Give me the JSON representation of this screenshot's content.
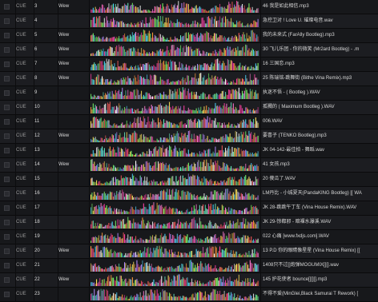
{
  "columns": {
    "cue_label": "CUE"
  },
  "rows": [
    {
      "cue": "CUE",
      "num": "3",
      "tag": "Wew",
      "title": "46 我是如此相信.mp3"
    },
    {
      "cue": "CUE",
      "num": "4",
      "tag": "",
      "title": "急控卫对 ! Love U. 璀璨电音.wav"
    },
    {
      "cue": "CUE",
      "num": "5",
      "tag": "Wew",
      "title": "我的未来式 (FarAlly Bootleg).mp3"
    },
    {
      "cue": "CUE",
      "num": "6",
      "tag": "Wew",
      "title": "30 飞儿乐团 - 你的微笑 (Mr2ard Bootleg) - .m"
    },
    {
      "cue": "CUE",
      "num": "7",
      "tag": "Wew",
      "title": "16 三国恋.mp3"
    },
    {
      "cue": "CUE",
      "num": "8",
      "tag": "Wew",
      "title": "25 陈瑞铭-跳舞街 (Bithe Vina Remix).mp3"
    },
    {
      "cue": "CUE",
      "num": "9",
      "tag": "",
      "title": "执迷不悟 - ( Bootleg ).WAV"
    },
    {
      "cue": "CUE",
      "num": "10",
      "tag": "",
      "title": "孤獨的 ( Maximum Bootleg ).WAV"
    },
    {
      "cue": "CUE",
      "num": "11",
      "tag": "",
      "title": "006.WAV"
    },
    {
      "cue": "CUE",
      "num": "12",
      "tag": "Wew",
      "title": "要喜子 (TENKO Bootleg).mp3"
    },
    {
      "cue": "CUE",
      "num": "13",
      "tag": "",
      "title": "JK 04-142-最佳拍 - 舞蹈.wav"
    },
    {
      "cue": "CUE",
      "num": "14",
      "tag": "Wew",
      "title": "41 女孩.mp3"
    },
    {
      "cue": "CUE",
      "num": "15",
      "tag": "",
      "title": "20 傻瓜了.WAV"
    },
    {
      "cue": "CUE",
      "num": "16",
      "tag": "",
      "title": "LM丹比 - 小城夏天(PandaKING Bootleg) [[ WA"
    },
    {
      "cue": "CUE",
      "num": "17",
      "tag": "",
      "title": "JK 28-跳跳午丁车 (Vina House Remix).WAV"
    },
    {
      "cue": "CUE",
      "num": "18",
      "tag": "",
      "title": "JK 29-惊都邪 - 暗裸水瀑溪.WAV"
    },
    {
      "cue": "CUE",
      "num": "19",
      "tag": "",
      "title": "022 心痛 [www.fxdjs.com].WAV"
    },
    {
      "cue": "CUE",
      "num": "20",
      "tag": "Wew",
      "title": "13 P.D 你的眼睛像星星 (Vina House Remix) [["
    },
    {
      "cue": "CUE",
      "num": "21",
      "tag": "",
      "title": "1408只不过[]炮弹MOGUMIX[][].wav"
    },
    {
      "cue": "CUE",
      "num": "22",
      "tag": "Wew",
      "title": "145 护花使者 bounce[][][].mp3"
    },
    {
      "cue": "CUE",
      "num": "23",
      "tag": "",
      "title": "不得不爱(MinGlei,Black Samurai T Rework) ["
    }
  ]
}
